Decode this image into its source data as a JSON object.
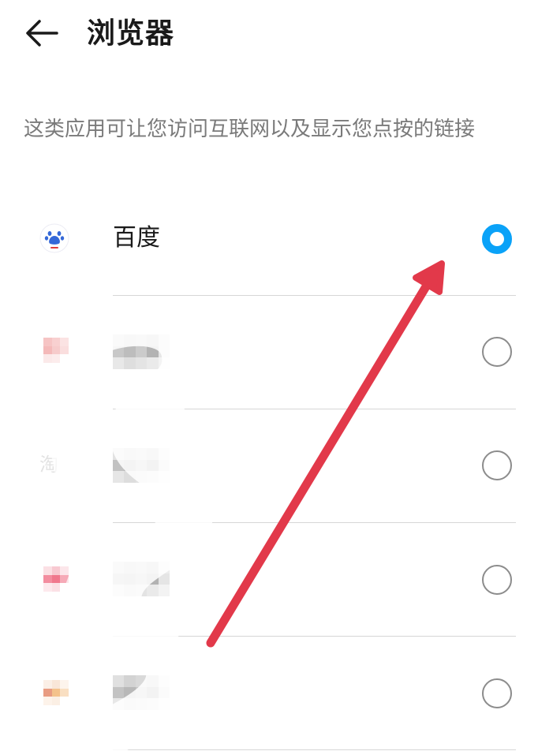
{
  "header": {
    "title": "浏览器",
    "back_icon": "arrow-left-icon"
  },
  "description": "这类应用可让您访问互联网以及显示您点按的链接",
  "apps": [
    {
      "label": "百度",
      "icon": "baidu-paw-icon",
      "selected": true
    },
    {
      "label": "",
      "icon": "blurred-app-icon",
      "selected": false,
      "blurred": true
    },
    {
      "label": "",
      "icon": "taobao-icon",
      "icon_text": "淘",
      "selected": false,
      "blurred": true
    },
    {
      "label": "",
      "icon": "blurred-app-icon",
      "selected": false,
      "blurred": true
    },
    {
      "label": "",
      "icon": "blurred-app-icon",
      "selected": false,
      "blurred": true
    }
  ],
  "annotation": {
    "type": "red-arrow",
    "color": "#e2394a",
    "points_to": "百度 radio button"
  },
  "colors": {
    "accent": "#0aa2f8",
    "radio_border": "#8c8c8c",
    "divider": "#d6d6d6",
    "description_text": "#7a7a7a"
  }
}
